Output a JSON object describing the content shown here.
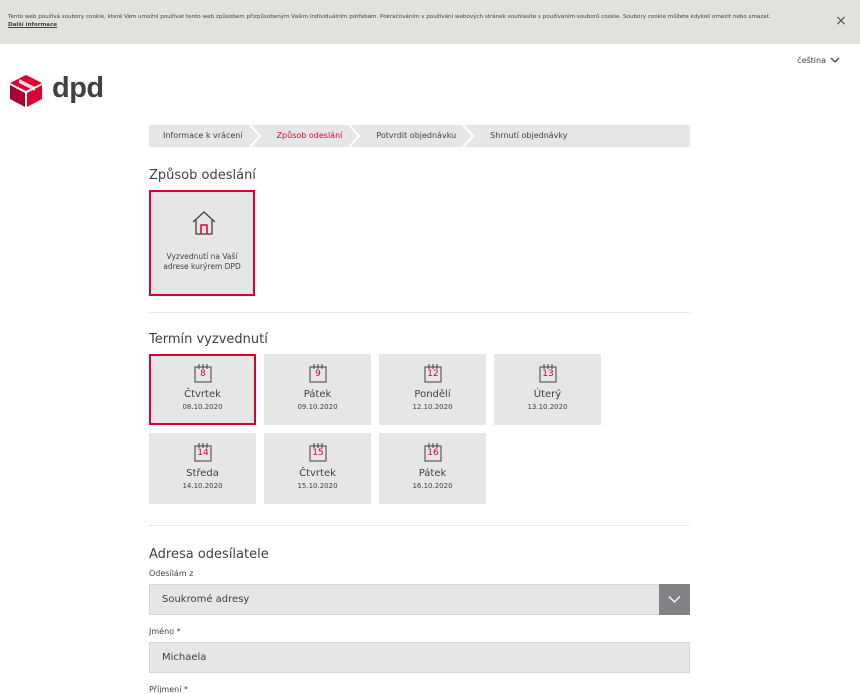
{
  "cookie": {
    "text": "Tento web používá soubory cookie, které Vám umožní používat tento web způsobem přizpůsobeným Vašim individuálním potřebám. Pokračováním v používání webových stránek souhlasíte s používáním souborů cookie. Soubory cookie můžete kdykoli omezit nebo smazat.",
    "link": "Další informace",
    "close": "×"
  },
  "header": {
    "language": "čeština",
    "logo_text": "dpd"
  },
  "breadcrumb": [
    {
      "label": "Informace k vrácení",
      "active": false
    },
    {
      "label": "Způsob odeslání",
      "active": true
    },
    {
      "label": "Potvrdit objednávku",
      "active": false
    },
    {
      "label": "Shrnutí objednávky",
      "active": false
    }
  ],
  "shipping": {
    "title": "Způsob odeslání",
    "option_label": "Vyzvednutí na Vaší adrese kurýrem DPD"
  },
  "pickup": {
    "title": "Termín vyzvednutí",
    "days": [
      {
        "num": "8",
        "name": "Čtvrtek",
        "date": "08.10.2020",
        "selected": true
      },
      {
        "num": "9",
        "name": "Pátek",
        "date": "09.10.2020",
        "selected": false
      },
      {
        "num": "12",
        "name": "Pondělí",
        "date": "12.10.2020",
        "selected": false
      },
      {
        "num": "13",
        "name": "Úterý",
        "date": "13.10.2020",
        "selected": false
      },
      {
        "num": "14",
        "name": "Středa",
        "date": "14.10.2020",
        "selected": false
      },
      {
        "num": "15",
        "name": "Čtvrtek",
        "date": "15.10.2020",
        "selected": false
      },
      {
        "num": "16",
        "name": "Pátek",
        "date": "16.10.2020",
        "selected": false
      }
    ]
  },
  "sender": {
    "title": "Adresa odesílatele",
    "from_label": "Odesílám z",
    "from_value": "Soukromé adresy",
    "firstname_label": "Jméno *",
    "firstname_value": "Michaela",
    "lastname_label": "Příjmení *"
  },
  "colors": {
    "accent": "#dc0032",
    "card": "#e6e6e6",
    "text": "#414042"
  }
}
